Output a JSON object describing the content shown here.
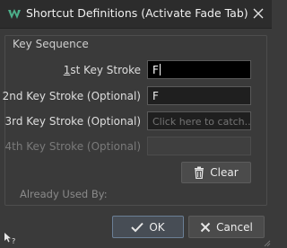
{
  "window": {
    "title": "Shortcut Definitions (Activate Fade Tab)",
    "icon": "app-logo-icon"
  },
  "group": {
    "title": "Key Sequence"
  },
  "rows": [
    {
      "label": "1st Key Stroke",
      "value": "F",
      "state": "focused"
    },
    {
      "label": "2nd Key Stroke (Optional)",
      "value": "F",
      "state": "normal"
    },
    {
      "label": "3rd Key Stroke (Optional)",
      "value": "Click here to catch...",
      "state": "placeholder"
    },
    {
      "label": "4th Key Stroke (Optional)",
      "value": "",
      "state": "disabled"
    }
  ],
  "clear_button": {
    "label": "Clear",
    "icon": "trash-icon"
  },
  "used_by": {
    "label": "Already Used By:"
  },
  "footer": {
    "ok_label": "OK",
    "cancel_label": "Cancel"
  },
  "colors": {
    "background": "#3a3a3a",
    "titlebar": "#2c2c2c",
    "accent": "#4caf8a"
  }
}
